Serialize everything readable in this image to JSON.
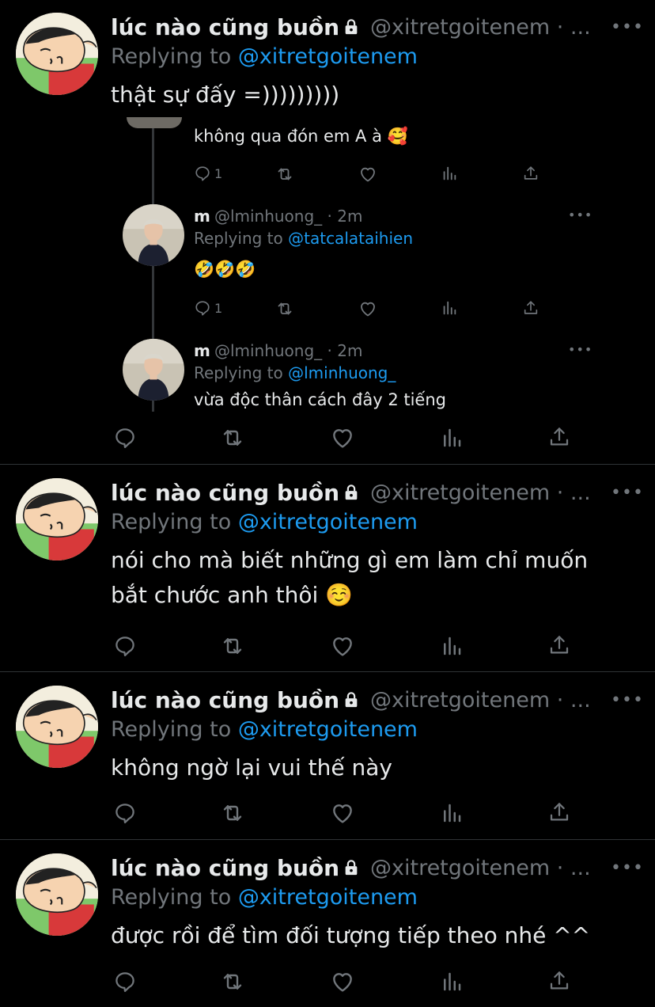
{
  "tweets": [
    {
      "name": "lúc nào cũng buồn",
      "handle": "@xitretgoitenem · ...",
      "reply_prefix": "Replying to ",
      "reply_to": "@xitretgoitenem",
      "text_lines": [
        "thật sự đấy =)))))))))"
      ]
    },
    {
      "name": "lúc nào cũng buồn",
      "handle": "@xitretgoitenem · ...",
      "reply_prefix": "Replying to ",
      "reply_to": "@xitretgoitenem",
      "text_lines": [
        "nói cho mà biết những gì em làm chỉ muốn",
        "bắt chước anh thôi ☺️"
      ]
    },
    {
      "name": "lúc nào cũng buồn",
      "handle": "@xitretgoitenem · ...",
      "reply_prefix": "Replying to ",
      "reply_to": "@xitretgoitenem",
      "text_lines": [
        "không ngờ lại vui thế này"
      ]
    },
    {
      "name": "lúc nào cũng buồn",
      "handle": "@xitretgoitenem · ...",
      "reply_prefix": "Replying to ",
      "reply_to": "@xitretgoitenem",
      "text_lines": [
        "được rồi để tìm đối tượng tiếp theo nhé ^^"
      ]
    }
  ],
  "quoted": {
    "top_text": "không qua đón em A à 🥰",
    "top_reply_count": "1",
    "replies": [
      {
        "name": "m",
        "handle": "@lminhuong_ · 2m",
        "reply_prefix": "Replying to ",
        "reply_to": "@tatcalataihien",
        "text": "🤣🤣🤣",
        "reply_count": "1"
      },
      {
        "name": "m",
        "handle": "@lminhuong_ · 2m",
        "reply_prefix": "Replying to ",
        "reply_to": "@lminhuong_",
        "text": "vừa độc thân cách đây 2 tiếng"
      }
    ]
  },
  "more_label": "•••",
  "icons": [
    "reply-icon",
    "retweet-icon",
    "like-icon",
    "analytics-icon",
    "share-icon",
    "lock-icon",
    "more-icon"
  ],
  "colors": {
    "background": "#000000",
    "text": "#e7e9ea",
    "muted": "#71767b",
    "link": "#1d9bf0",
    "divider": "#2f3336"
  }
}
